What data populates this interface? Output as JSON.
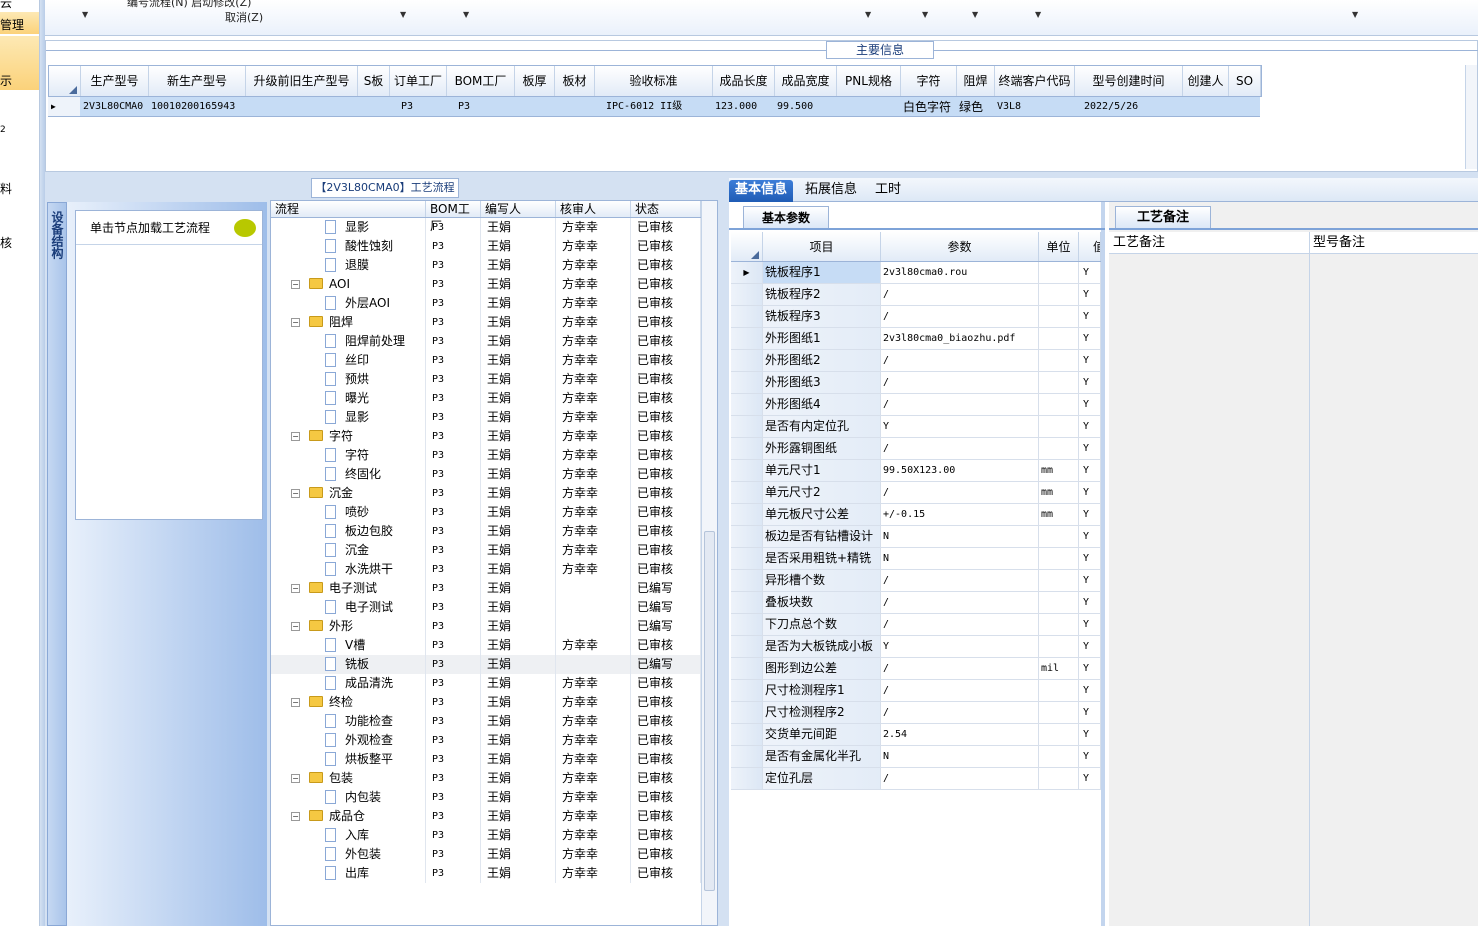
{
  "left_strip": [
    "云",
    "管理",
    "示",
    "2",
    "料",
    "核"
  ],
  "toolbar": {
    "line1": "编号流程(N)  启动修改(Z)",
    "cancel": "取消(Z)"
  },
  "main": {
    "title": "主要信息",
    "columns": [
      "生产型号",
      "新生产型号",
      "升级前旧生产型号",
      "S板",
      "订单工厂",
      "BOM工厂",
      "板厚",
      "板材",
      "验收标准",
      "成品长度",
      "成品宽度",
      "PNL规格",
      "字符",
      "阻焊",
      "终端客户代码",
      "型号创建时间",
      "创建人",
      "SO"
    ],
    "row": [
      "2V3L80CMA0",
      "10010200165943",
      "",
      "",
      "P3",
      "P3",
      "",
      "",
      "IPC-6012 II级",
      "123.000",
      "99.500",
      "",
      "白色字符",
      "绿色",
      "V3L8",
      "2022/5/26",
      "",
      ""
    ]
  },
  "left": {
    "sidebar_label": "设备结构",
    "load_label": "单击节点加载工艺流程"
  },
  "tree": {
    "title": "【2V3L80CMA0】工艺流程",
    "columns": [
      "流程",
      "BOM工厂",
      "编写人",
      "核审人",
      "状态"
    ],
    "rows": [
      {
        "n": "显影",
        "lvl": 2,
        "f": "P3",
        "w": "王娟",
        "r": "方幸幸",
        "s": "已审核"
      },
      {
        "n": "酸性蚀刻",
        "lvl": 2,
        "f": "P3",
        "w": "王娟",
        "r": "方幸幸",
        "s": "已审核"
      },
      {
        "n": "退膜",
        "lvl": 2,
        "f": "P3",
        "w": "王娟",
        "r": "方幸幸",
        "s": "已审核"
      },
      {
        "n": "AOI",
        "lvl": 1,
        "f": "P3",
        "w": "王娟",
        "r": "方幸幸",
        "s": "已审核"
      },
      {
        "n": "外层AOI",
        "lvl": 2,
        "f": "P3",
        "w": "王娟",
        "r": "方幸幸",
        "s": "已审核"
      },
      {
        "n": "阻焊",
        "lvl": 1,
        "f": "P3",
        "w": "王娟",
        "r": "方幸幸",
        "s": "已审核"
      },
      {
        "n": "阻焊前处理",
        "lvl": 2,
        "f": "P3",
        "w": "王娟",
        "r": "方幸幸",
        "s": "已审核"
      },
      {
        "n": "丝印",
        "lvl": 2,
        "f": "P3",
        "w": "王娟",
        "r": "方幸幸",
        "s": "已审核"
      },
      {
        "n": "预烘",
        "lvl": 2,
        "f": "P3",
        "w": "王娟",
        "r": "方幸幸",
        "s": "已审核"
      },
      {
        "n": "曝光",
        "lvl": 2,
        "f": "P3",
        "w": "王娟",
        "r": "方幸幸",
        "s": "已审核"
      },
      {
        "n": "显影",
        "lvl": 2,
        "f": "P3",
        "w": "王娟",
        "r": "方幸幸",
        "s": "已审核"
      },
      {
        "n": "字符",
        "lvl": 1,
        "f": "P3",
        "w": "王娟",
        "r": "方幸幸",
        "s": "已审核"
      },
      {
        "n": "字符",
        "lvl": 2,
        "f": "P3",
        "w": "王娟",
        "r": "方幸幸",
        "s": "已审核"
      },
      {
        "n": "终固化",
        "lvl": 2,
        "f": "P3",
        "w": "王娟",
        "r": "方幸幸",
        "s": "已审核"
      },
      {
        "n": "沉金",
        "lvl": 1,
        "f": "P3",
        "w": "王娟",
        "r": "方幸幸",
        "s": "已审核"
      },
      {
        "n": "喷砂",
        "lvl": 2,
        "f": "P3",
        "w": "王娟",
        "r": "方幸幸",
        "s": "已审核"
      },
      {
        "n": "板边包胶",
        "lvl": 2,
        "f": "P3",
        "w": "王娟",
        "r": "方幸幸",
        "s": "已审核"
      },
      {
        "n": "沉金",
        "lvl": 2,
        "f": "P3",
        "w": "王娟",
        "r": "方幸幸",
        "s": "已审核"
      },
      {
        "n": "水洗烘干",
        "lvl": 2,
        "f": "P3",
        "w": "王娟",
        "r": "方幸幸",
        "s": "已审核"
      },
      {
        "n": "电子测试",
        "lvl": 1,
        "f": "P3",
        "w": "王娟",
        "r": "",
        "s": "已编写"
      },
      {
        "n": "电子测试",
        "lvl": 2,
        "f": "P3",
        "w": "王娟",
        "r": "",
        "s": "已编写"
      },
      {
        "n": "外形",
        "lvl": 1,
        "f": "P3",
        "w": "王娟",
        "r": "",
        "s": "已编写"
      },
      {
        "n": "V槽",
        "lvl": 2,
        "f": "P3",
        "w": "王娟",
        "r": "方幸幸",
        "s": "已审核"
      },
      {
        "n": "铣板",
        "lvl": 2,
        "f": "P3",
        "w": "王娟",
        "r": "",
        "s": "已编写",
        "sel": true
      },
      {
        "n": "成品清洗",
        "lvl": 2,
        "f": "P3",
        "w": "王娟",
        "r": "方幸幸",
        "s": "已审核"
      },
      {
        "n": "终检",
        "lvl": 1,
        "f": "P3",
        "w": "王娟",
        "r": "方幸幸",
        "s": "已审核"
      },
      {
        "n": "功能检查",
        "lvl": 2,
        "f": "P3",
        "w": "王娟",
        "r": "方幸幸",
        "s": "已审核"
      },
      {
        "n": "外观检查",
        "lvl": 2,
        "f": "P3",
        "w": "王娟",
        "r": "方幸幸",
        "s": "已审核"
      },
      {
        "n": "烘板整平",
        "lvl": 2,
        "f": "P3",
        "w": "王娟",
        "r": "方幸幸",
        "s": "已审核"
      },
      {
        "n": "包装",
        "lvl": 1,
        "f": "P3",
        "w": "王娟",
        "r": "方幸幸",
        "s": "已审核"
      },
      {
        "n": "内包装",
        "lvl": 2,
        "f": "P3",
        "w": "王娟",
        "r": "方幸幸",
        "s": "已审核"
      },
      {
        "n": "成品仓",
        "lvl": 1,
        "f": "P3",
        "w": "王娟",
        "r": "方幸幸",
        "s": "已审核"
      },
      {
        "n": "入库",
        "lvl": 2,
        "f": "P3",
        "w": "王娟",
        "r": "方幸幸",
        "s": "已审核"
      },
      {
        "n": "外包装",
        "lvl": 2,
        "f": "P3",
        "w": "王娟",
        "r": "方幸幸",
        "s": "已审核"
      },
      {
        "n": "出库",
        "lvl": 2,
        "f": "P3",
        "w": "王娟",
        "r": "方幸幸",
        "s": "已审核"
      }
    ]
  },
  "right": {
    "tabs": [
      "基本信息",
      "拓展信息",
      "工时"
    ],
    "basic_tab": "基本参数",
    "param_columns": [
      "项目",
      "参数",
      "单位",
      "值"
    ],
    "params": [
      [
        "铣板程序1",
        "2v3l80cma0.rou",
        "",
        "Y"
      ],
      [
        "铣板程序2",
        "/",
        "",
        "Y"
      ],
      [
        "铣板程序3",
        "/",
        "",
        "Y"
      ],
      [
        "外形图纸1",
        "2v3l80cma0_biaozhu.pdf",
        "",
        "Y"
      ],
      [
        "外形图纸2",
        "/",
        "",
        "Y"
      ],
      [
        "外形图纸3",
        "/",
        "",
        "Y"
      ],
      [
        "外形图纸4",
        "/",
        "",
        "Y"
      ],
      [
        "是否有内定位孔",
        "Y",
        "",
        "Y"
      ],
      [
        "外形露铜图纸",
        "/",
        "",
        "Y"
      ],
      [
        "单元尺寸1",
        "99.50X123.00",
        "mm",
        "Y"
      ],
      [
        "单元尺寸2",
        "/",
        "mm",
        "Y"
      ],
      [
        "单元板尺寸公差",
        "+/-0.15",
        "mm",
        "Y"
      ],
      [
        "板边是否有钻槽设计",
        "N",
        "",
        "Y"
      ],
      [
        "是否采用粗铣+精铣",
        "N",
        "",
        "Y"
      ],
      [
        "异形槽个数",
        "/",
        "",
        "Y"
      ],
      [
        "叠板块数",
        "/",
        "",
        "Y"
      ],
      [
        "下刀点总个数",
        "/",
        "",
        "Y"
      ],
      [
        "是否为大板铣成小板",
        "Y",
        "",
        "Y"
      ],
      [
        "图形到边公差",
        "/",
        "mil",
        "Y"
      ],
      [
        "尺寸检测程序1",
        "/",
        "",
        "Y"
      ],
      [
        "尺寸检测程序2",
        "/",
        "",
        "Y"
      ],
      [
        "交货单元间距",
        "2.54",
        "",
        "Y"
      ],
      [
        "是否有金属化半孔",
        "N",
        "",
        "Y"
      ],
      [
        "定位孔层",
        "/",
        "",
        "Y"
      ]
    ],
    "notes_tab": "工艺备注",
    "notes_columns": [
      "工艺备注",
      "型号备注"
    ]
  }
}
